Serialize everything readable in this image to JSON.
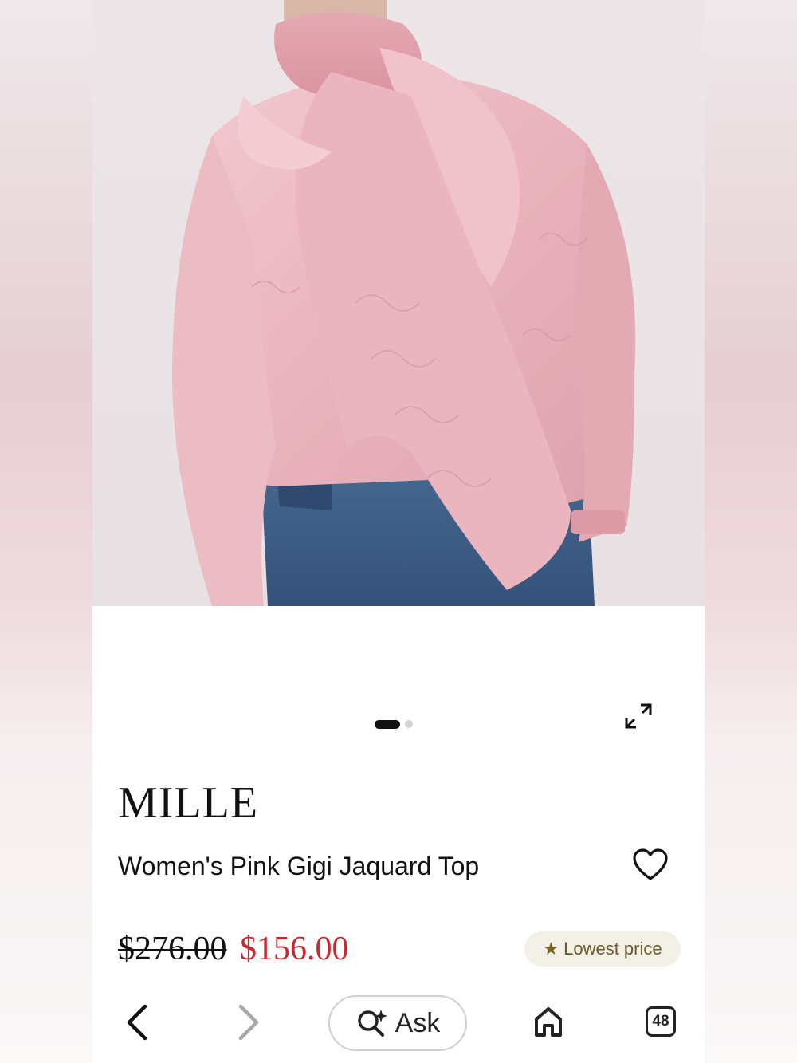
{
  "product": {
    "brand": "MILLE",
    "title": "Women's Pink Gigi Jaquard Top",
    "original_price": "$276.00",
    "sale_price": "$156.00",
    "badge": "Lowest price",
    "badge_icon": "star-icon"
  },
  "carousel": {
    "total_images": 2,
    "active_index": 1
  },
  "bottom_nav": {
    "ask_label": "Ask",
    "tab_count": "48"
  },
  "colors": {
    "sale_price": "#c8282f",
    "badge_bg": "#f3f0e7",
    "badge_text": "#6b5a2a",
    "blouse_pink": "#eab8c0",
    "jeans_blue": "#3f5f86"
  }
}
